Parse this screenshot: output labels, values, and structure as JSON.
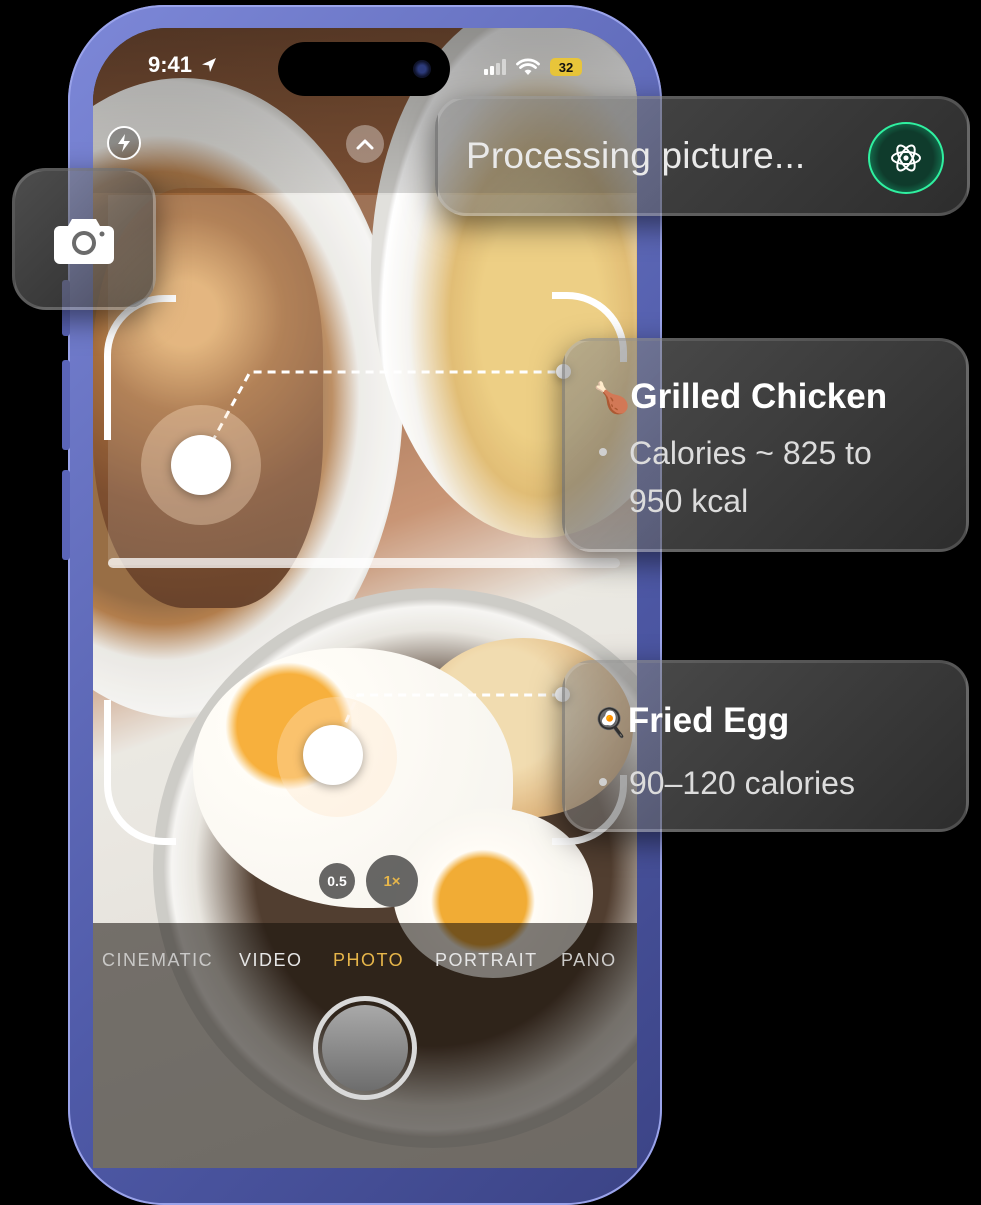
{
  "status_bar": {
    "time": "9:41",
    "battery": "32"
  },
  "processing": {
    "label": "Processing picture..."
  },
  "detections": [
    {
      "emoji": "🍗",
      "name": "Grilled Chicken",
      "detail_lines": [
        "Calories ~ 825 to",
        "950 kcal"
      ]
    },
    {
      "emoji": "🍳",
      "name": "Fried Egg",
      "detail_lines": [
        "90–120 calories"
      ]
    }
  ],
  "zoom": {
    "wide": "0.5",
    "main": "1×"
  },
  "camera_modes": [
    "CINEMATIC",
    "VIDEO",
    "PHOTO",
    "PORTRAIT",
    "PANO"
  ],
  "active_mode": "PHOTO",
  "colors": {
    "active_mode": "#e7b64a",
    "ai_accent": "#2ff0a0",
    "phone_frame": "#6a74c9"
  },
  "icons": [
    "flash-icon",
    "chevron-up-icon",
    "camera-icon",
    "ai-atom-icon",
    "location-arrow-icon",
    "wifi-icon",
    "signal-icon"
  ]
}
